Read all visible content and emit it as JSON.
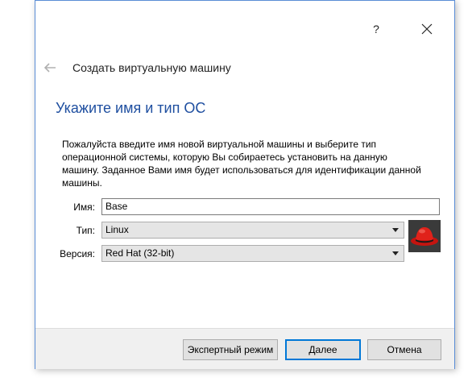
{
  "window": {
    "help_label": "?",
    "close_icon": "close-icon"
  },
  "wizard": {
    "title": "Создать виртуальную машину",
    "back_icon": "back-arrow-icon"
  },
  "page": {
    "heading": "Укажите имя и тип ОС",
    "description": "Пожалуйста введите имя новой виртуальной машины и выберите тип операционной системы, которую Вы собираетесь установить на данную машину. Заданное Вами имя будет использоваться для идентификации данной машины."
  },
  "form": {
    "name_label": "Имя:",
    "name_value": "Base",
    "type_label": "Тип:",
    "type_value": "Linux",
    "version_label": "Версия:",
    "version_value": "Red Hat (32-bit)",
    "os_icon": "redhat-icon"
  },
  "buttons": {
    "expert": "Экспертный режим",
    "next": "Далее",
    "cancel": "Отмена"
  },
  "colors": {
    "heading": "#1f4fa0",
    "window_border": "#5a8dd6",
    "default_button_border": "#0078d7"
  }
}
